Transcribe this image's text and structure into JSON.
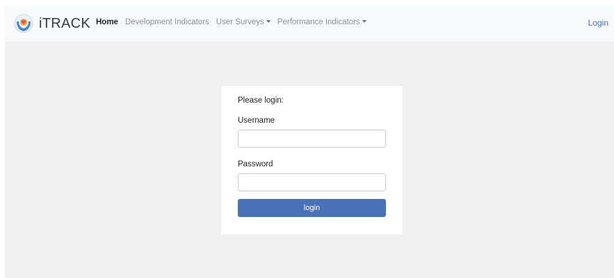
{
  "navbar": {
    "brand": {
      "logo_icon": "itrack-logo-icon",
      "text": "iTRACK"
    },
    "items": [
      {
        "label": "Home",
        "active": true,
        "dropdown": false
      },
      {
        "label": "Development Indicators",
        "active": false,
        "dropdown": false
      },
      {
        "label": "User Surveys",
        "active": false,
        "dropdown": true
      },
      {
        "label": "Performance Indicators",
        "active": false,
        "dropdown": true
      }
    ],
    "login_label": "Login"
  },
  "login_form": {
    "heading": "Please login:",
    "username_label": "Username",
    "username_value": "",
    "password_label": "Password",
    "password_value": "",
    "submit_label": "login"
  },
  "colors": {
    "navbar_bg": "#f8f9fa",
    "page_bg": "#f1f1f1",
    "primary_button": "#4a72b8",
    "link": "#3a6fc4"
  }
}
